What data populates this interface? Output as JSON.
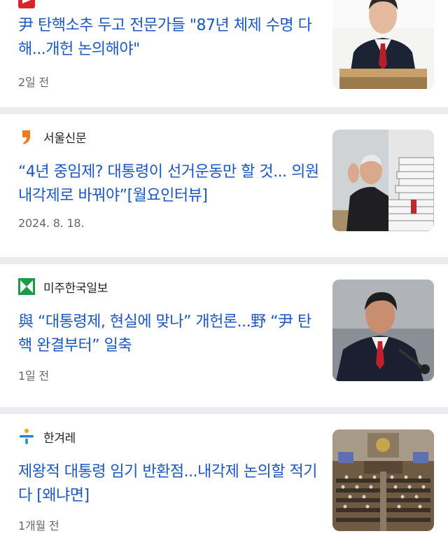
{
  "articles": [
    {
      "source": "",
      "logo_icon": "red-news-logo-icon",
      "title": "尹 탄핵소추 두고 전문가들 \"87년 체제 수명 다해...개헌 논의해야\"",
      "time": "2일 전",
      "thumb": "man-in-suit-at-podium"
    },
    {
      "source": "서울신문",
      "logo_icon": "orange-comma-logo-icon",
      "title": "“4년 중임제? 대통령이 선거운동만 할 것... 의원내각제로 바꿔야”[월요인터뷰]",
      "time": "2024. 8. 18.",
      "thumb": "elderly-man-with-books"
    },
    {
      "source": "미주한국일보",
      "logo_icon": "green-x-logo-icon",
      "title": "與 “대통령제, 현실에 맞나” 개헌론...野 “尹 탄핵 완결부터” 일축",
      "time": "1일 전",
      "thumb": "man-speaking-at-microphone"
    },
    {
      "source": "한겨레",
      "logo_icon": "hankyoreh-logo-icon",
      "title": "제왕적 대통령 임기 반환점...내각제 논의할 적기다 [왜냐면]",
      "time": "1개월 전",
      "thumb": "national-assembly-hall"
    }
  ],
  "colors": {
    "title": "#1b57c2",
    "background": "#e9ebee",
    "card": "#ffffff"
  }
}
